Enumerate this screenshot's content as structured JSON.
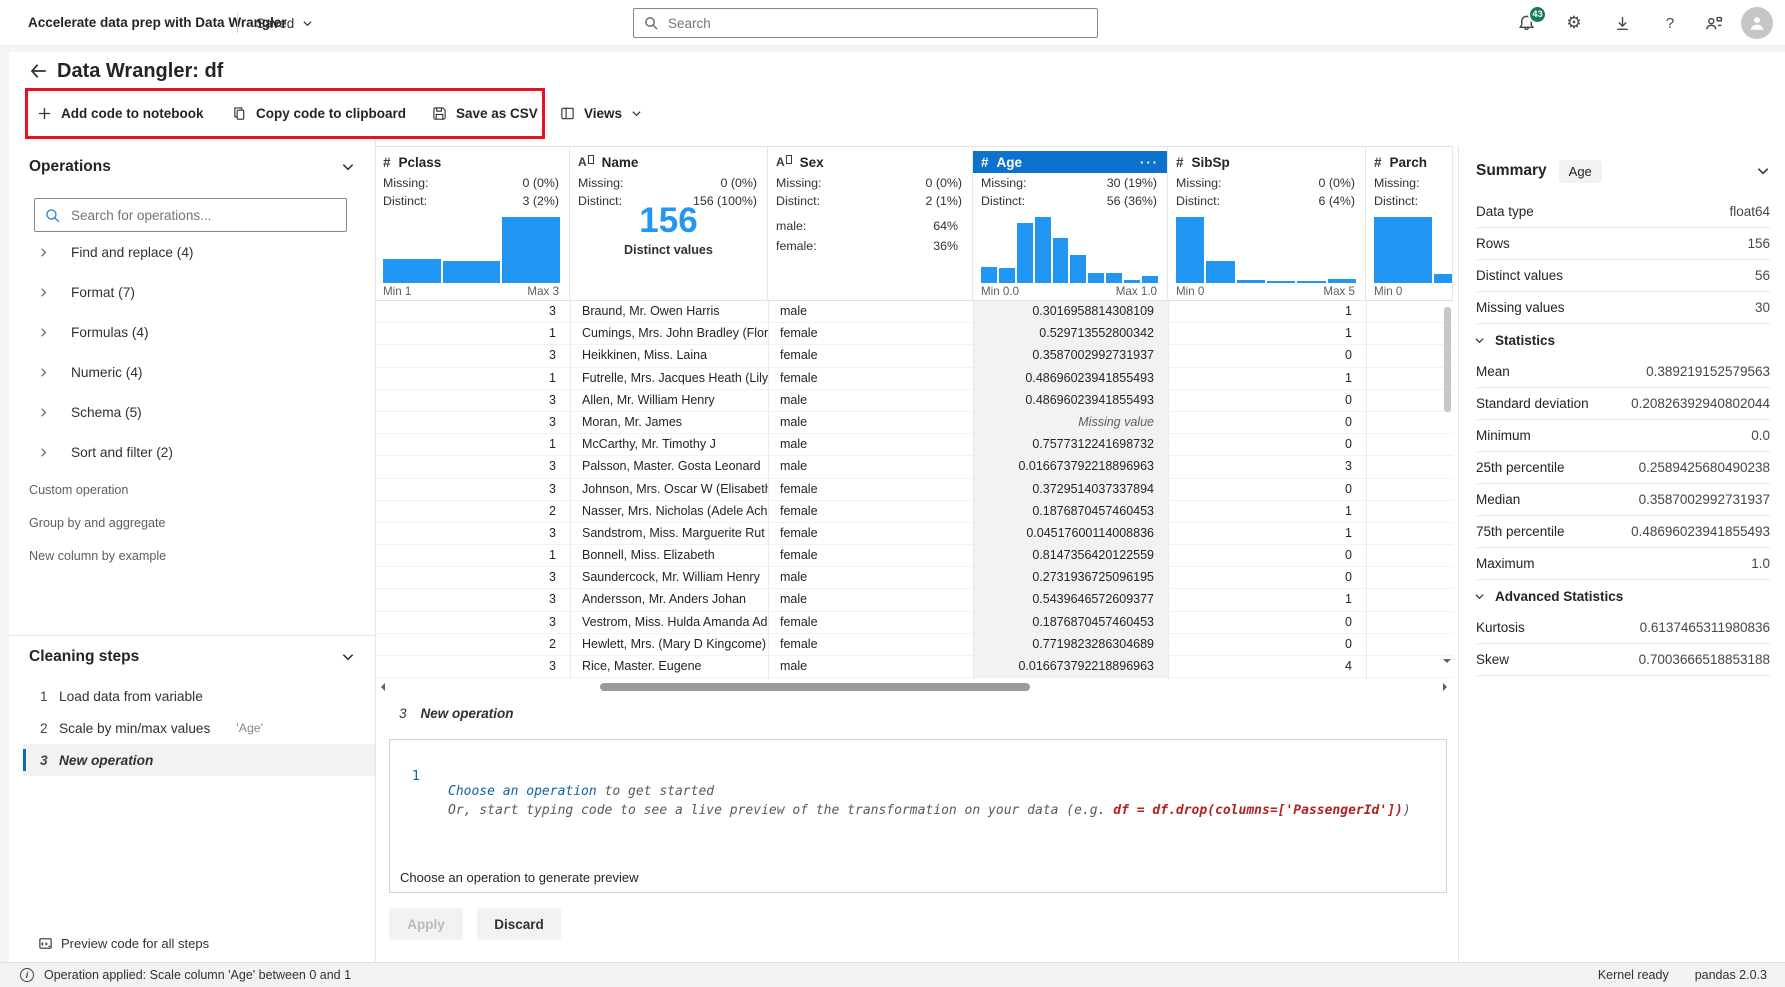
{
  "top_bar": {
    "app_title": "Accelerate data prep with Data Wrangler",
    "saved_label": "Saved",
    "search_placeholder": "Search",
    "notification_count": "43"
  },
  "header": {
    "title": "Data Wrangler: df"
  },
  "toolbar": {
    "add_code_label": "Add code to notebook",
    "copy_code_label": "Copy code to clipboard",
    "save_csv_label": "Save as CSV",
    "views_label": "Views"
  },
  "operations": {
    "title": "Operations",
    "search_placeholder": "Search for operations...",
    "categories": [
      "Find and replace (4)",
      "Format (7)",
      "Formulas (4)",
      "Numeric (4)",
      "Schema (5)",
      "Sort and filter (2)"
    ],
    "items": [
      "Custom operation",
      "Group by and aggregate",
      "New column by example"
    ]
  },
  "cleaning_steps": {
    "title": "Cleaning steps",
    "steps": [
      {
        "num": "1",
        "label": "Load data from variable",
        "annotation": "",
        "selected": false
      },
      {
        "num": "2",
        "label": "Scale by min/max values",
        "annotation": "'Age'",
        "selected": false
      },
      {
        "num": "3",
        "label": "New operation",
        "annotation": "",
        "selected": true
      }
    ],
    "preview_all_label": "Preview code for all steps"
  },
  "grid": {
    "missing_label": "Missing:",
    "distinct_label": "Distinct:",
    "columns": [
      {
        "id": "pclass",
        "name": "Pclass",
        "type": "numeric",
        "missing": "0 (0%)",
        "distinct": "3 (2%)",
        "viz": "histogram",
        "histogram": [
          0.36,
          0.34,
          1.0
        ],
        "min_label": "Min 1",
        "max_label": "Max 3",
        "selected": false
      },
      {
        "id": "name",
        "name": "Name",
        "type": "text",
        "missing": "0 (0%)",
        "distinct": "156 (100%)",
        "viz": "bignum",
        "big_number": "156",
        "big_caption": "Distinct values",
        "selected": false
      },
      {
        "id": "sex",
        "name": "Sex",
        "type": "text",
        "missing": "0 (0%)",
        "distinct": "2 (1%)",
        "viz": "categories",
        "cats": [
          {
            "label": "male:",
            "value": "64%"
          },
          {
            "label": "female:",
            "value": "36%"
          }
        ],
        "selected": false
      },
      {
        "id": "age",
        "name": "Age",
        "type": "numeric",
        "missing": "30 (19%)",
        "distinct": "56 (36%)",
        "viz": "histogram",
        "histogram": [
          0.25,
          0.23,
          0.91,
          1.0,
          0.68,
          0.42,
          0.15,
          0.15,
          0.04,
          0.11
        ],
        "min_label": "Min 0.0",
        "max_label": "Max 1.0",
        "selected": true,
        "menu_dots": "···"
      },
      {
        "id": "sibsp",
        "name": "SibSp",
        "type": "numeric",
        "missing": "0 (0%)",
        "distinct": "6 (4%)",
        "viz": "histogram",
        "histogram": [
          1.0,
          0.34,
          0.05,
          0.03,
          0.02,
          0.06
        ],
        "min_label": "Min 0",
        "max_label": "Max 5",
        "selected": false
      },
      {
        "id": "parch",
        "name": "Parch",
        "type": "numeric",
        "missing": "",
        "distinct": "",
        "viz": "histogram",
        "histogram": [
          1.0,
          0.13,
          0.04
        ],
        "min_label": "Min 0",
        "max_label": "",
        "selected": false,
        "clipped": true
      }
    ],
    "missing_value_text": "Missing value",
    "rows": [
      {
        "pclass": "3",
        "name": "Braund, Mr. Owen Harris",
        "sex": "male",
        "age": "0.3016958814308109",
        "age_missing": false,
        "sibsp": "1"
      },
      {
        "pclass": "1",
        "name": "Cumings, Mrs. John Bradley (Florenc",
        "sex": "female",
        "age": "0.529713552800342",
        "age_missing": false,
        "sibsp": "1"
      },
      {
        "pclass": "3",
        "name": "Heikkinen, Miss. Laina",
        "sex": "female",
        "age": "0.3587002992731937",
        "age_missing": false,
        "sibsp": "0"
      },
      {
        "pclass": "1",
        "name": "Futrelle, Mrs. Jacques Heath (Lily Ma",
        "sex": "female",
        "age": "0.48696023941855493",
        "age_missing": false,
        "sibsp": "1"
      },
      {
        "pclass": "3",
        "name": "Allen, Mr. William Henry",
        "sex": "male",
        "age": "0.48696023941855493",
        "age_missing": false,
        "sibsp": "0"
      },
      {
        "pclass": "3",
        "name": "Moran, Mr. James",
        "sex": "male",
        "age": "Missing value",
        "age_missing": true,
        "sibsp": "0"
      },
      {
        "pclass": "1",
        "name": "McCarthy, Mr. Timothy J",
        "sex": "male",
        "age": "0.7577312241698732",
        "age_missing": false,
        "sibsp": "0"
      },
      {
        "pclass": "3",
        "name": "Palsson, Master. Gosta Leonard",
        "sex": "male",
        "age": "0.016673792218896963",
        "age_missing": false,
        "sibsp": "3"
      },
      {
        "pclass": "3",
        "name": "Johnson, Mrs. Oscar W (Elisabeth Vil",
        "sex": "female",
        "age": "0.3729514037337894",
        "age_missing": false,
        "sibsp": "0"
      },
      {
        "pclass": "2",
        "name": "Nasser, Mrs. Nicholas (Adele Achem",
        "sex": "female",
        "age": "0.1876870457460453",
        "age_missing": false,
        "sibsp": "1"
      },
      {
        "pclass": "3",
        "name": "Sandstrom, Miss. Marguerite Rut",
        "sex": "female",
        "age": "0.04517600114008836",
        "age_missing": false,
        "sibsp": "1"
      },
      {
        "pclass": "1",
        "name": "Bonnell, Miss. Elizabeth",
        "sex": "female",
        "age": "0.8147356420122559",
        "age_missing": false,
        "sibsp": "0"
      },
      {
        "pclass": "3",
        "name": "Saundercock, Mr. William Henry",
        "sex": "male",
        "age": "0.2731936725096195",
        "age_missing": false,
        "sibsp": "0"
      },
      {
        "pclass": "3",
        "name": "Andersson, Mr. Anders Johan",
        "sex": "male",
        "age": "0.5439646572609377",
        "age_missing": false,
        "sibsp": "1"
      },
      {
        "pclass": "3",
        "name": "Vestrom, Miss. Hulda Amanda Adolf",
        "sex": "female",
        "age": "0.1876870457460453",
        "age_missing": false,
        "sibsp": "0"
      },
      {
        "pclass": "2",
        "name": "Hewlett, Mrs. (Mary D Kingcome)",
        "sex": "female",
        "age": "0.7719823286304689",
        "age_missing": false,
        "sibsp": "0"
      },
      {
        "pclass": "3",
        "name": "Rice, Master. Eugene",
        "sex": "male",
        "age": "0.016673792218896963",
        "age_missing": false,
        "sibsp": "4"
      }
    ]
  },
  "code_panel": {
    "step_number": "3",
    "step_label": "New operation",
    "line_number": "1",
    "line1_code": "Choose an operation",
    "line1_rest": " to get started",
    "line2_pre": "Or, start typing code to see a live preview of the transformation on your data (e.g. ",
    "line2_code": "df = df.drop(columns=['PassengerId'])",
    "line2_post": ")",
    "footer_note": "Choose an operation to generate preview",
    "apply_label": "Apply",
    "discard_label": "Discard"
  },
  "summary": {
    "title": "Summary",
    "chip": "Age",
    "rows": [
      {
        "kind": "row",
        "label": "Data type",
        "value": "float64"
      },
      {
        "kind": "row",
        "label": "Rows",
        "value": "156"
      },
      {
        "kind": "row",
        "label": "Distinct values",
        "value": "56"
      },
      {
        "kind": "row",
        "label": "Missing values",
        "value": "30"
      },
      {
        "kind": "section",
        "label": "Statistics"
      },
      {
        "kind": "row",
        "label": "Mean",
        "value": "0.389219152579563"
      },
      {
        "kind": "row",
        "label": "Standard deviation",
        "value": "0.20826392940802044"
      },
      {
        "kind": "row",
        "label": "Minimum",
        "value": "0.0"
      },
      {
        "kind": "row",
        "label": "25th percentile",
        "value": "0.2589425680490238"
      },
      {
        "kind": "row",
        "label": "Median",
        "value": "0.3587002992731937"
      },
      {
        "kind": "row",
        "label": "75th percentile",
        "value": "0.48696023941855493"
      },
      {
        "kind": "row",
        "label": "Maximum",
        "value": "1.0"
      },
      {
        "kind": "section",
        "label": "Advanced Statistics"
      },
      {
        "kind": "row",
        "label": "Kurtosis",
        "value": "0.6137465311980836"
      },
      {
        "kind": "row",
        "label": "Skew",
        "value": "0.7003666518853188"
      }
    ]
  },
  "status_bar": {
    "message": "Operation applied: Scale column 'Age' between 0 and 1",
    "kernel_status": "Kernel ready",
    "pandas_version": "pandas 2.0.3"
  },
  "icons": {
    "topbar": [
      "bell-icon",
      "gear-icon",
      "download-icon",
      "help-icon",
      "share-icon",
      "avatar"
    ],
    "toolbar": [
      "plus-icon",
      "copy-icon",
      "save-icon",
      "views-icon"
    ],
    "other": [
      "back-arrow-icon",
      "search-icon",
      "chevron-down-icon",
      "chevron-right-icon",
      "info-icon",
      "preview-code-icon"
    ]
  },
  "colors": {
    "accent_blue": "#0f6cbd",
    "histogram_blue": "#2196f3",
    "selected_header_blue": "#0d72ce",
    "highlight_red_box": "#e81123",
    "badge_green": "#107c5a",
    "code_blue": "#1261a3",
    "code_red": "#b22222"
  }
}
